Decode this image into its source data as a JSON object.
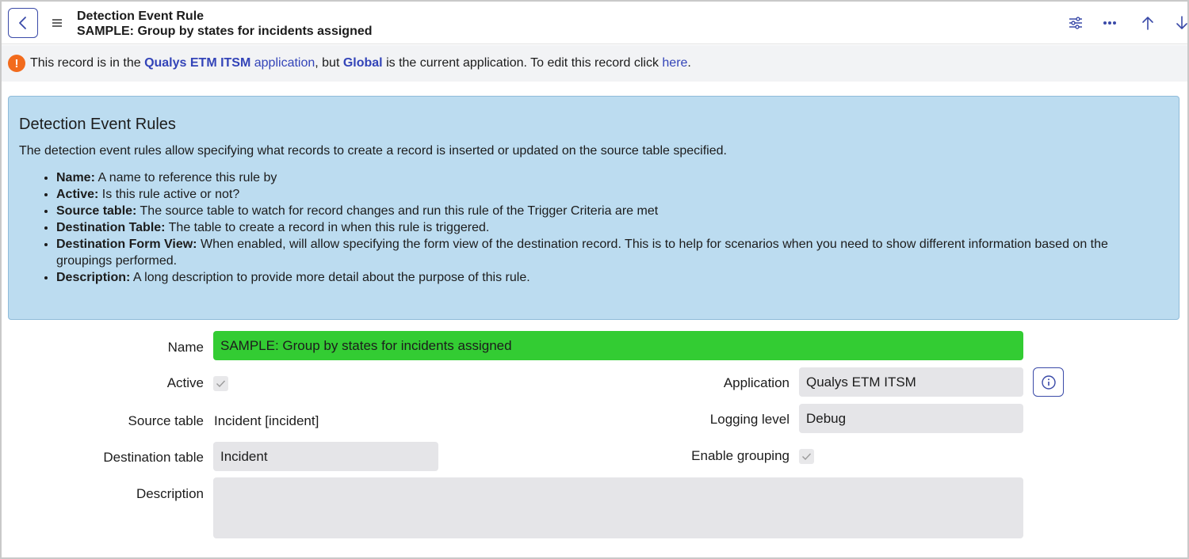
{
  "header": {
    "title": "Detection Event Rule",
    "subtitle": "SAMPLE: Group by states for incidents assigned",
    "icons": [
      "back-icon",
      "hamburger-menu-icon",
      "settings-sliders-icon",
      "more-options-icon",
      "arrow-up-icon",
      "arrow-down-icon"
    ]
  },
  "notice": {
    "text_1": "This record is in the ",
    "app_name": "Qualys ETM ITSM",
    "app_link": " application",
    "text_2": ", but ",
    "global": "Global",
    "text_3": " is the current application. To edit this record click ",
    "here": "here",
    "text_4": ".",
    "icon": "warning-icon"
  },
  "info": {
    "heading": "Detection Event Rules",
    "intro": "The detection event rules allow specifying what records to create a record is inserted or updated on the source table specified.",
    "items": [
      {
        "term": "Name:",
        "desc": " A name to reference this rule by"
      },
      {
        "term": "Active:",
        "desc": " Is this rule active or not?"
      },
      {
        "term": "Source table:",
        "desc": " The source table to watch for record changes and run this rule of the Trigger Criteria are met"
      },
      {
        "term": "Destination Table:",
        "desc": " The table to create a record in when this rule is triggered."
      },
      {
        "term": "Destination Form View:",
        "desc": " When enabled, will allow specifying the form view of the destination record. This is to help for scenarios when you need to show different information based on the groupings performed."
      },
      {
        "term": "Description:",
        "desc": " A long description to provide more detail about the purpose of this rule."
      }
    ]
  },
  "form": {
    "name_label": "Name",
    "name_value": "SAMPLE: Group by states for incidents assigned",
    "active_label": "Active",
    "application_label": "Application",
    "application_value": "Qualys ETM ITSM",
    "source_table_label": "Source table",
    "source_table_value": "Incident [incident]",
    "logging_level_label": "Logging level",
    "logging_level_value": "Debug",
    "destination_table_label": "Destination table",
    "destination_table_value": "Incident",
    "enable_grouping_label": "Enable grouping",
    "description_label": "Description",
    "description_value": ""
  },
  "colors": {
    "accent": "#3344b8",
    "name_field_bg": "#33cc33",
    "info_bg": "#bcdcf0",
    "warning": "#f26b1d"
  }
}
